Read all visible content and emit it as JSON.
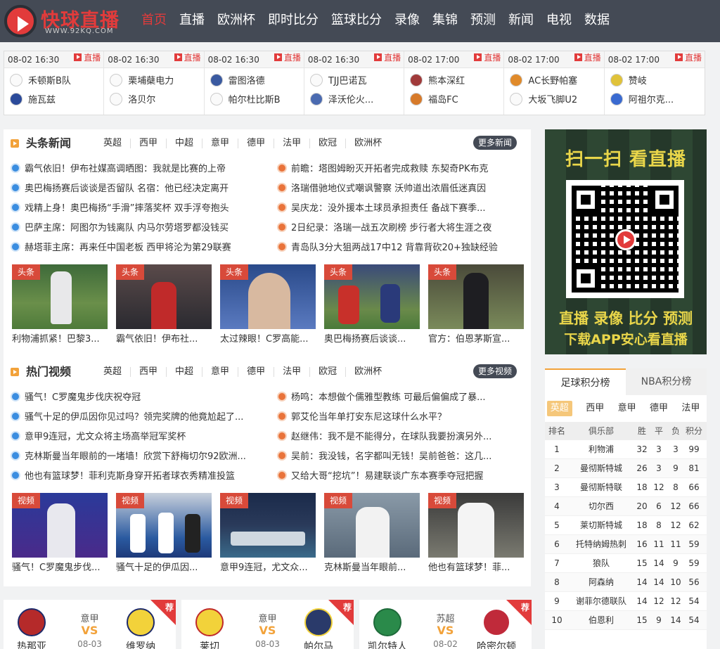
{
  "nav": {
    "logo_text": "快球直播",
    "logo_url": "WWW.92KQ.COM",
    "items": [
      "首页",
      "直播",
      "欧洲杯",
      "即时比分",
      "篮球比分",
      "录像",
      "集锦",
      "预测",
      "新闻",
      "电视",
      "数据"
    ],
    "active_index": 0,
    "accent": "#e23b3b",
    "bg": "#444a55"
  },
  "matches": [
    {
      "time": "08-02 16:30",
      "live": "直播",
      "home": "禾顿斯B队",
      "away": "施瓦兹"
    },
    {
      "time": "08-02 16:30",
      "live": "直播",
      "home": "栗埔蘗电力",
      "away": "洛贝尔"
    },
    {
      "time": "08-02 16:30",
      "live": "直播",
      "home": "雷图洛德",
      "away": "帕尔杜比斯B"
    },
    {
      "time": "08-02 16:30",
      "live": "直播",
      "home": "TJJ巴诺瓦",
      "away": "泽沃伦火..."
    },
    {
      "time": "08-02 17:00",
      "live": "直播",
      "home": "熊本深红",
      "away": "福岛FC"
    },
    {
      "time": "08-02 17:00",
      "live": "直播",
      "home": "AC长野帕塞",
      "away": "大坂飞脚U2"
    },
    {
      "time": "08-02 17:00",
      "live": "直播",
      "home": "赞岐",
      "away": "阿祖尔克..."
    }
  ],
  "headlines": {
    "title": "头条新闻",
    "tabs": [
      "英超",
      "西甲",
      "中超",
      "意甲",
      "德甲",
      "法甲",
      "欧冠",
      "欧洲杯"
    ],
    "more": "更多新闻",
    "left": [
      "霸气依旧！伊布社媒高调晒图：我就是比赛的上帝",
      "奥巴梅扬赛后谈谈是否留队 名宿：他已经决定离开",
      "戏精上身！奥巴梅扬“手滑”摔落奖杯 双手浮夸抱头",
      "巴萨主席：阿图尔为钱离队 内马尔劳塔罗都没钱买",
      "赫塔菲主席：再来任中国老板 西甲将沦为第29联赛"
    ],
    "right": [
      "前瞻：塔图姆盼灭开拓者完成救赎 东契奇PK布克",
      "洛瑞借驰地仪式嘲讽警察 沃帅道出浓眉低迷真因",
      "吴庆龙：没外援本土球员承担责任 备战下赛季...",
      "2日纪录：洛瑞一战五次刷榜 步行者大将生涯之夜",
      "青岛队3分大狙两战17中12 背靠背砍20+独缺经验"
    ],
    "cards": [
      {
        "tag": "头条",
        "caption": "利物浦抓紧！巴黎3..."
      },
      {
        "tag": "头条",
        "caption": "霸气依旧！伊布社..."
      },
      {
        "tag": "头条",
        "caption": "太过辣眼！C罗高能..."
      },
      {
        "tag": "头条",
        "caption": "奥巴梅扬赛后谈谈..."
      },
      {
        "tag": "头条",
        "caption": "官方：伯恩茅斯宣..."
      }
    ]
  },
  "videos": {
    "title": "热门视频",
    "tabs": [
      "英超",
      "西甲",
      "中超",
      "意甲",
      "德甲",
      "法甲",
      "欧冠",
      "欧洲杯"
    ],
    "more": "更多视频",
    "left": [
      "骚气！C罗魔鬼步伐庆祝夺冠",
      "骚气十足的伊瓜因你见过吗？领完奖牌的他竟尬起了...",
      "意甲9连冠，尤文众将主场高举冠军奖杯",
      "克林斯曼当年眼前的一堵墙！欣赏下舒梅切尔92欧洲...",
      "他也有篮球梦！菲利克斯身穿开拓者球衣秀精准投篮"
    ],
    "right": [
      "杨鸣：本想做个儒雅型教练 可最后偏偏成了暴...",
      "郭艾伦当年单打安东尼这球什么水平？",
      "赵继伟：我不是不能得分，在球队我要扮演另外...",
      "吴前：我没钱，名字都叫无钱！吴前爸爸：这几...",
      "又给大哥“挖坑”！易建联谈广东本赛季夺冠把握"
    ],
    "cards": [
      {
        "tag": "视频",
        "caption": "骚气！C罗魔鬼步伐..."
      },
      {
        "tag": "视频",
        "caption": "骚气十足的伊瓜因..."
      },
      {
        "tag": "视频",
        "caption": "意甲9连冠，尤文众..."
      },
      {
        "tag": "视频",
        "caption": "克林斯曼当年眼前..."
      },
      {
        "tag": "视频",
        "caption": "他也有篮球梦！菲..."
      }
    ]
  },
  "qr": {
    "line1": "扫一扫 看直播",
    "line2": "直播 录像 比分 预测",
    "line3": "下载APP安心看直播"
  },
  "standings": {
    "tabs": [
      "足球积分榜",
      "NBA积分榜"
    ],
    "leagues": [
      "英超",
      "西甲",
      "意甲",
      "德甲",
      "法甲"
    ],
    "headers": [
      "排名",
      "俱乐部",
      "胜",
      "平",
      "负",
      "积分"
    ],
    "rows": [
      [
        "1",
        "利物浦",
        "32",
        "3",
        "3",
        "99"
      ],
      [
        "2",
        "曼彻斯特城",
        "26",
        "3",
        "9",
        "81"
      ],
      [
        "3",
        "曼彻斯特联",
        "18",
        "12",
        "8",
        "66"
      ],
      [
        "4",
        "切尔西",
        "20",
        "6",
        "12",
        "66"
      ],
      [
        "5",
        "莱切斯特城",
        "18",
        "8",
        "12",
        "62"
      ],
      [
        "6",
        "托特纳姆热刺",
        "16",
        "11",
        "11",
        "59"
      ],
      [
        "7",
        "狼队",
        "15",
        "14",
        "9",
        "59"
      ],
      [
        "8",
        "阿森纳",
        "14",
        "14",
        "10",
        "56"
      ],
      [
        "9",
        "谢菲尔德联队",
        "14",
        "12",
        "12",
        "54"
      ],
      [
        "10",
        "伯恩利",
        "15",
        "9",
        "14",
        "54"
      ]
    ]
  },
  "recommend": [
    {
      "flag": "荐",
      "league": "意甲",
      "vs": "VS",
      "date": "08-03",
      "home": "热那亚",
      "away": "维罗纳"
    },
    {
      "flag": "荐",
      "league": "意甲",
      "vs": "VS",
      "date": "08-03",
      "home": "莱切",
      "away": "帕尔马"
    },
    {
      "flag": "荐",
      "league": "苏超",
      "vs": "VS",
      "date": "08-02",
      "home": "凯尔特人",
      "away": "哈密尔顿"
    }
  ]
}
